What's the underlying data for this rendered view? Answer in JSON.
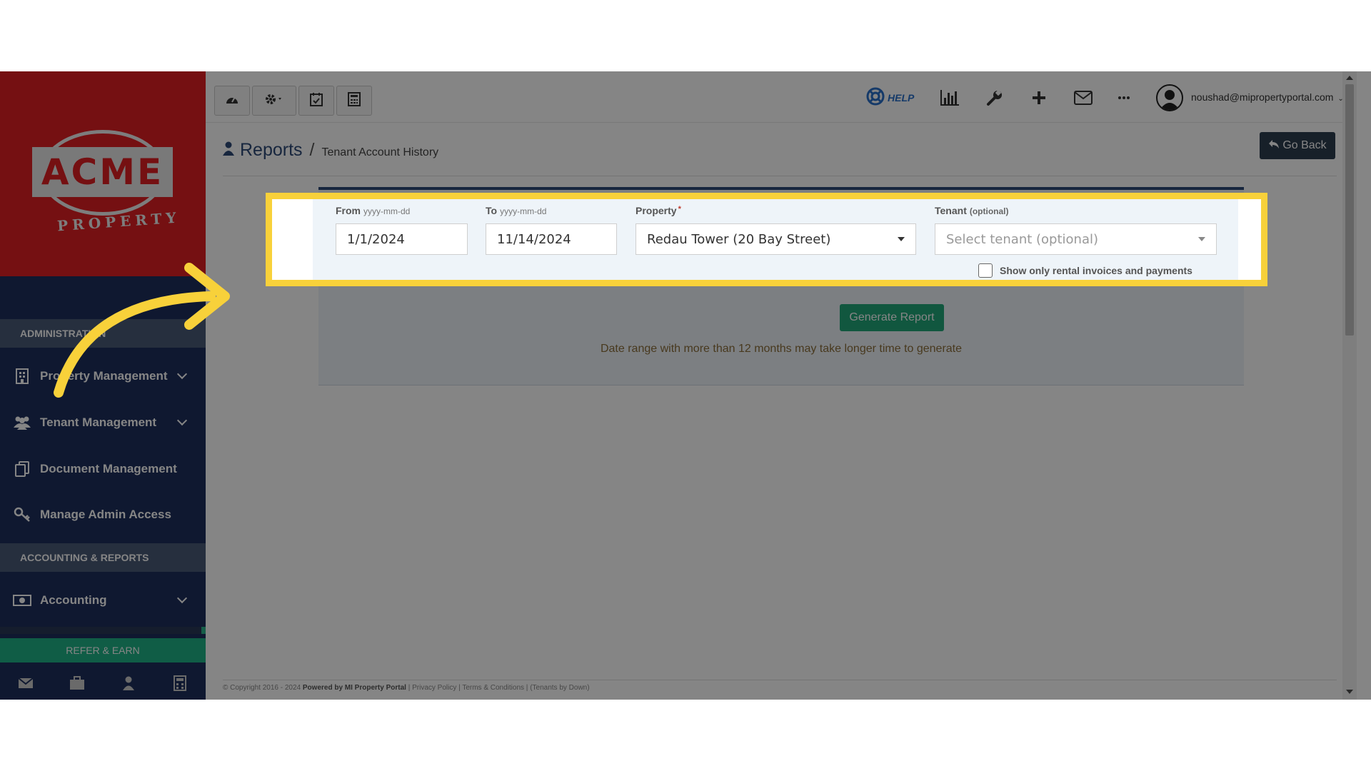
{
  "sidebar": {
    "logo_text": "ACME",
    "logo_subtext": "PROPERTY",
    "sections": [
      {
        "label": "ADMINISTRATION"
      },
      {
        "label": "ACCOUNTING & REPORTS"
      }
    ],
    "items": [
      {
        "label": "Property Management",
        "icon": "building-icon"
      },
      {
        "label": "Tenant Management",
        "icon": "users-icon"
      },
      {
        "label": "Document Management",
        "icon": "documents-icon"
      },
      {
        "label": "Manage Admin Access",
        "icon": "key-icon"
      },
      {
        "label": "Accounting",
        "icon": "money-icon"
      }
    ],
    "refer_label": "REFER & EARN",
    "bottom_icons": [
      "envelope-icon",
      "briefcase-icon",
      "user-icon",
      "calculator-icon"
    ]
  },
  "topbar": {
    "help_label": "HELP",
    "user_email": "noushad@mipropertyportal.com",
    "toolbar_icons": [
      "dashboard-icon",
      "gear-icon",
      "calendar-check-icon",
      "calculator-icon"
    ],
    "right_icons": [
      "bar-chart-icon",
      "wrench-icon",
      "plus-icon",
      "envelope-icon",
      "ellipsis-icon"
    ]
  },
  "page": {
    "breadcrumb_title": "Reports",
    "breadcrumb_separator": "/",
    "breadcrumb_sub": "Tenant Account History",
    "go_back_label": "Go Back"
  },
  "form": {
    "from_label": "From",
    "from_hint": "yyyy-mm-dd",
    "from_value": "1/1/2024",
    "to_label": "To",
    "to_hint": "yyyy-mm-dd",
    "to_value": "11/14/2024",
    "property_label": "Property",
    "property_required": "*",
    "property_value": "Redau Tower (20 Bay Street)",
    "tenant_label": "Tenant",
    "tenant_hint": "(optional)",
    "tenant_placeholder": "Select tenant (optional)",
    "checkbox_label": "Show only rental invoices and payments",
    "generate_label": "Generate Report",
    "warning": "Date range with more than 12 months may take longer time to generate"
  },
  "footer": {
    "copyright": "© Copyright 2016 - 2024",
    "powered": "Powered by MI Property Portal",
    "privacy": "Privacy Policy",
    "terms": "Terms & Conditions",
    "tenants": "(Tenants by Down)"
  },
  "colors": {
    "brand_red": "#e01f24",
    "sidebar_navy": "#1e2f5c",
    "highlight_yellow": "#f8d13a",
    "success_green": "#22a77a"
  }
}
